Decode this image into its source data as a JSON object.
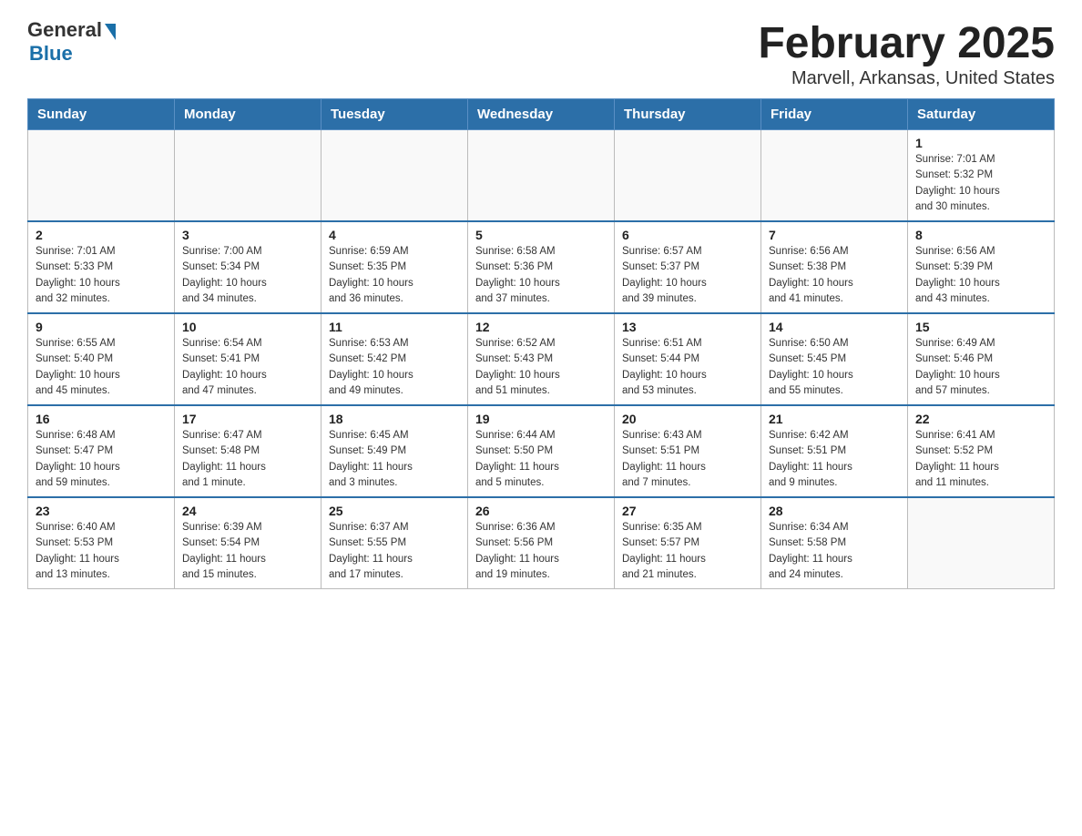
{
  "header": {
    "logo_general": "General",
    "logo_blue": "Blue",
    "title": "February 2025",
    "subtitle": "Marvell, Arkansas, United States"
  },
  "weekdays": [
    "Sunday",
    "Monday",
    "Tuesday",
    "Wednesday",
    "Thursday",
    "Friday",
    "Saturday"
  ],
  "weeks": [
    [
      {
        "day": "",
        "info": ""
      },
      {
        "day": "",
        "info": ""
      },
      {
        "day": "",
        "info": ""
      },
      {
        "day": "",
        "info": ""
      },
      {
        "day": "",
        "info": ""
      },
      {
        "day": "",
        "info": ""
      },
      {
        "day": "1",
        "info": "Sunrise: 7:01 AM\nSunset: 5:32 PM\nDaylight: 10 hours\nand 30 minutes."
      }
    ],
    [
      {
        "day": "2",
        "info": "Sunrise: 7:01 AM\nSunset: 5:33 PM\nDaylight: 10 hours\nand 32 minutes."
      },
      {
        "day": "3",
        "info": "Sunrise: 7:00 AM\nSunset: 5:34 PM\nDaylight: 10 hours\nand 34 minutes."
      },
      {
        "day": "4",
        "info": "Sunrise: 6:59 AM\nSunset: 5:35 PM\nDaylight: 10 hours\nand 36 minutes."
      },
      {
        "day": "5",
        "info": "Sunrise: 6:58 AM\nSunset: 5:36 PM\nDaylight: 10 hours\nand 37 minutes."
      },
      {
        "day": "6",
        "info": "Sunrise: 6:57 AM\nSunset: 5:37 PM\nDaylight: 10 hours\nand 39 minutes."
      },
      {
        "day": "7",
        "info": "Sunrise: 6:56 AM\nSunset: 5:38 PM\nDaylight: 10 hours\nand 41 minutes."
      },
      {
        "day": "8",
        "info": "Sunrise: 6:56 AM\nSunset: 5:39 PM\nDaylight: 10 hours\nand 43 minutes."
      }
    ],
    [
      {
        "day": "9",
        "info": "Sunrise: 6:55 AM\nSunset: 5:40 PM\nDaylight: 10 hours\nand 45 minutes."
      },
      {
        "day": "10",
        "info": "Sunrise: 6:54 AM\nSunset: 5:41 PM\nDaylight: 10 hours\nand 47 minutes."
      },
      {
        "day": "11",
        "info": "Sunrise: 6:53 AM\nSunset: 5:42 PM\nDaylight: 10 hours\nand 49 minutes."
      },
      {
        "day": "12",
        "info": "Sunrise: 6:52 AM\nSunset: 5:43 PM\nDaylight: 10 hours\nand 51 minutes."
      },
      {
        "day": "13",
        "info": "Sunrise: 6:51 AM\nSunset: 5:44 PM\nDaylight: 10 hours\nand 53 minutes."
      },
      {
        "day": "14",
        "info": "Sunrise: 6:50 AM\nSunset: 5:45 PM\nDaylight: 10 hours\nand 55 minutes."
      },
      {
        "day": "15",
        "info": "Sunrise: 6:49 AM\nSunset: 5:46 PM\nDaylight: 10 hours\nand 57 minutes."
      }
    ],
    [
      {
        "day": "16",
        "info": "Sunrise: 6:48 AM\nSunset: 5:47 PM\nDaylight: 10 hours\nand 59 minutes."
      },
      {
        "day": "17",
        "info": "Sunrise: 6:47 AM\nSunset: 5:48 PM\nDaylight: 11 hours\nand 1 minute."
      },
      {
        "day": "18",
        "info": "Sunrise: 6:45 AM\nSunset: 5:49 PM\nDaylight: 11 hours\nand 3 minutes."
      },
      {
        "day": "19",
        "info": "Sunrise: 6:44 AM\nSunset: 5:50 PM\nDaylight: 11 hours\nand 5 minutes."
      },
      {
        "day": "20",
        "info": "Sunrise: 6:43 AM\nSunset: 5:51 PM\nDaylight: 11 hours\nand 7 minutes."
      },
      {
        "day": "21",
        "info": "Sunrise: 6:42 AM\nSunset: 5:51 PM\nDaylight: 11 hours\nand 9 minutes."
      },
      {
        "day": "22",
        "info": "Sunrise: 6:41 AM\nSunset: 5:52 PM\nDaylight: 11 hours\nand 11 minutes."
      }
    ],
    [
      {
        "day": "23",
        "info": "Sunrise: 6:40 AM\nSunset: 5:53 PM\nDaylight: 11 hours\nand 13 minutes."
      },
      {
        "day": "24",
        "info": "Sunrise: 6:39 AM\nSunset: 5:54 PM\nDaylight: 11 hours\nand 15 minutes."
      },
      {
        "day": "25",
        "info": "Sunrise: 6:37 AM\nSunset: 5:55 PM\nDaylight: 11 hours\nand 17 minutes."
      },
      {
        "day": "26",
        "info": "Sunrise: 6:36 AM\nSunset: 5:56 PM\nDaylight: 11 hours\nand 19 minutes."
      },
      {
        "day": "27",
        "info": "Sunrise: 6:35 AM\nSunset: 5:57 PM\nDaylight: 11 hours\nand 21 minutes."
      },
      {
        "day": "28",
        "info": "Sunrise: 6:34 AM\nSunset: 5:58 PM\nDaylight: 11 hours\nand 24 minutes."
      },
      {
        "day": "",
        "info": ""
      }
    ]
  ]
}
